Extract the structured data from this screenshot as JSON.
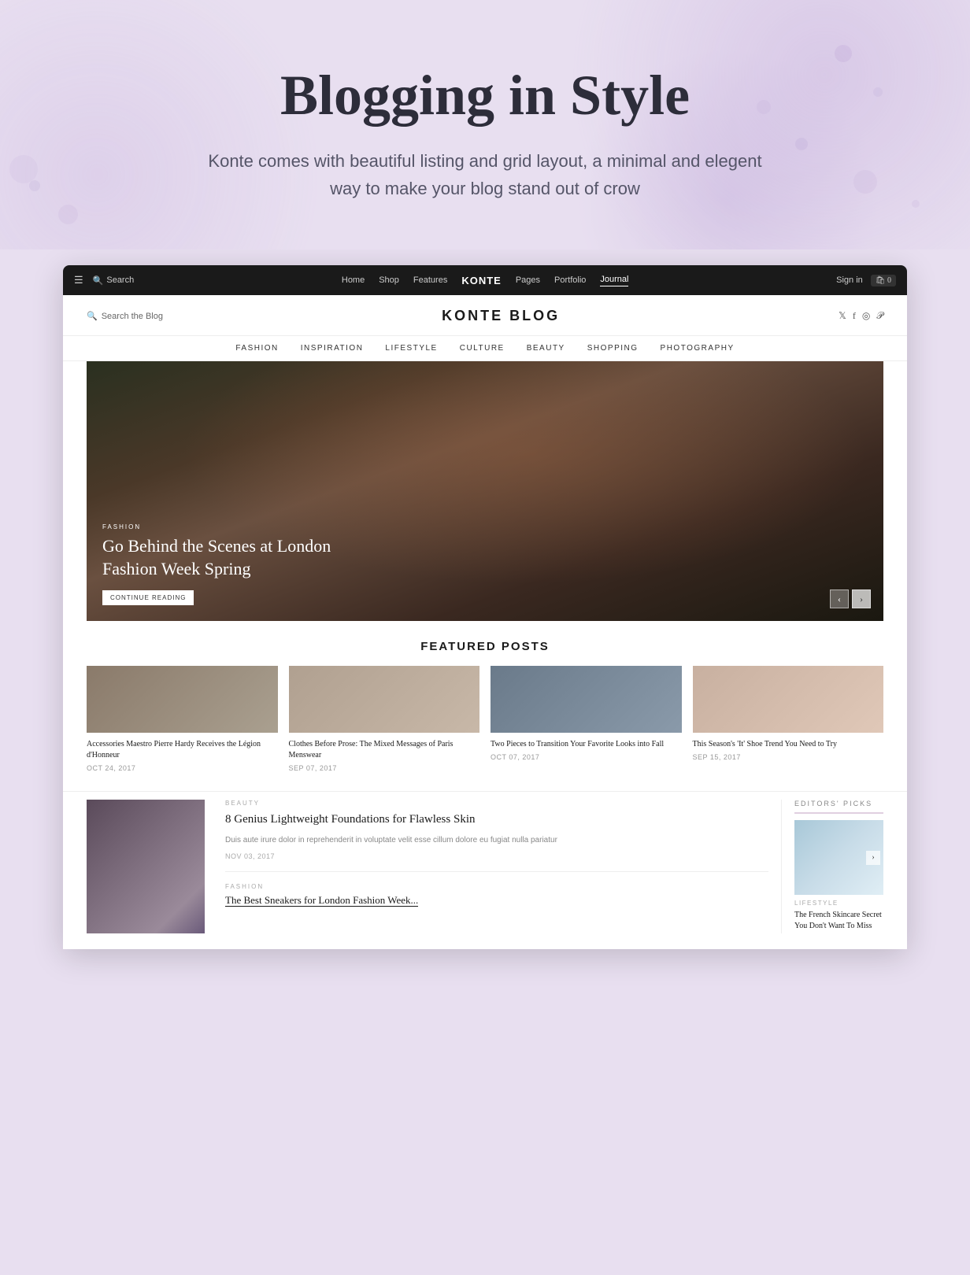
{
  "hero": {
    "title": "Blogging in Style",
    "subtitle": "Konte comes with beautiful listing and grid layout, a minimal and elegent way to make your blog stand out of crow"
  },
  "topnav": {
    "links": [
      "Home",
      "Shop",
      "Features",
      "KONTE",
      "Pages",
      "Portfolio",
      "Journal"
    ],
    "active": "Journal",
    "brand": "KONTE",
    "search_label": "Search",
    "signin_label": "Sign in",
    "cart_label": "🛍 0"
  },
  "blog": {
    "title": "KONTE BLOG",
    "search_placeholder": "Search the Blog",
    "categories": [
      "FASHION",
      "INSPIRATION",
      "LIFESTYLE",
      "CULTURE",
      "BEAUTY",
      "SHOPPING",
      "PHOTOGRAPHY"
    ],
    "hero_article": {
      "category": "FASHION",
      "title": "Go Behind the Scenes at London Fashion Week Spring",
      "cta": "CONTINUE READING"
    },
    "featured_section_title": "Featured Posts",
    "featured_posts": [
      {
        "title": "Accessories Maestro Pierre Hardy Receives the Légion d'Honneur",
        "date": "OCT 24, 2017",
        "color": "#8a7a6a"
      },
      {
        "title": "Clothes Before Prose: The Mixed Messages of Paris Menswear",
        "date": "SEP 07, 2017",
        "color": "#b0a090"
      },
      {
        "title": "Two Pieces to Transition Your Favorite Looks into Fall",
        "date": "OCT 07, 2017",
        "color": "#6a7a8a"
      },
      {
        "title": "This Season's 'It' Shoe Trend You Need to Try",
        "date": "SEP 15, 2017",
        "color": "#c8b0a0"
      }
    ],
    "main_article": {
      "category": "BEAUTY",
      "title": "8 Genius Lightweight Foundations for Flawless Skin",
      "excerpt": "Duis aute irure dolor in reprehenderit in voluptate velit esse cillum dolore eu fugiat nulla pariatur",
      "date": "NOV 03, 2017"
    },
    "second_article": {
      "category": "FASHION",
      "title": "The Best Sneakers for London Fashion Week..."
    },
    "editors_picks": {
      "label": "EDITORS' PICKS",
      "featured_cat": "LIFESTYLE",
      "featured_title": "The French Skincare Secret You Don't Want To Miss"
    }
  }
}
